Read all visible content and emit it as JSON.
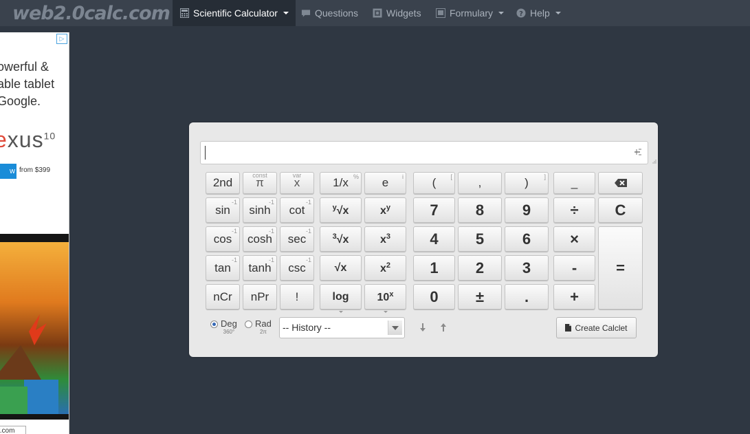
{
  "site": {
    "logo": "web2.0calc.com"
  },
  "nav": [
    {
      "label": "Scientific Calculator",
      "icon": "calculator-icon",
      "dropdown": true,
      "active": true
    },
    {
      "label": "Questions",
      "icon": "chat-icon",
      "dropdown": false
    },
    {
      "label": "Widgets",
      "icon": "widget-icon",
      "dropdown": false
    },
    {
      "label": "Formulary",
      "icon": "formulary-icon",
      "dropdown": true
    },
    {
      "label": "Help",
      "icon": "help-icon",
      "dropdown": true
    }
  ],
  "ad": {
    "text_lines": [
      "owerful &",
      "able tablet",
      "Google."
    ],
    "brand": "xus",
    "brand_sup": "10",
    "button_label": "w",
    "price": "from $399",
    "url_fragment": "r.com"
  },
  "calculator": {
    "display_value": "",
    "buttons": {
      "second": "2nd",
      "pi": "π",
      "pi_hint": "const",
      "x": "x",
      "x_hint": "var",
      "recip": "1/x",
      "recip_hint": "%",
      "e": "e",
      "e_hint": "i",
      "lparen": "(",
      "lparen_hint": "[",
      "comma": ",",
      "rparen": ")",
      "rparen_hint": "]",
      "underscore": "_",
      "sin": "sin",
      "sinh": "sinh",
      "cot": "cot",
      "yroot": "√x",
      "yroot_pre": "y",
      "xpow": "x",
      "xpow_sup": "y",
      "seven": "7",
      "eight": "8",
      "nine": "9",
      "divide": "÷",
      "clear": "C",
      "cos": "cos",
      "cosh": "cosh",
      "sec": "sec",
      "cbrt": "√x",
      "cbrt_pre": "3",
      "xcube": "x",
      "xcube_sup": "3",
      "four": "4",
      "five": "5",
      "six": "6",
      "multiply": "×",
      "equals": "=",
      "tan": "tan",
      "tanh": "tanh",
      "csc": "csc",
      "sqrt": "√x",
      "xsq": "x",
      "xsq_sup": "2",
      "one": "1",
      "two": "2",
      "three": "3",
      "minus": "-",
      "ncr": "nCr",
      "npr": "nPr",
      "fact": "!",
      "log": "log",
      "tenx": "10",
      "tenx_sup": "x",
      "zero": "0",
      "plusminus": "±",
      "dot": ".",
      "plus": "+",
      "inv_hint": "-1"
    },
    "angle": {
      "deg_label": "Deg",
      "deg_sub": "360°",
      "rad_label": "Rad",
      "rad_sub": "2π",
      "selected": "Deg"
    },
    "history_label": "-- History --",
    "create_calclet": "Create Calclet"
  },
  "colors": {
    "background": "#2f3742",
    "navbar": "#3a424d",
    "nav_active": "#262d36",
    "calc_panel": "#e8e8e8"
  }
}
